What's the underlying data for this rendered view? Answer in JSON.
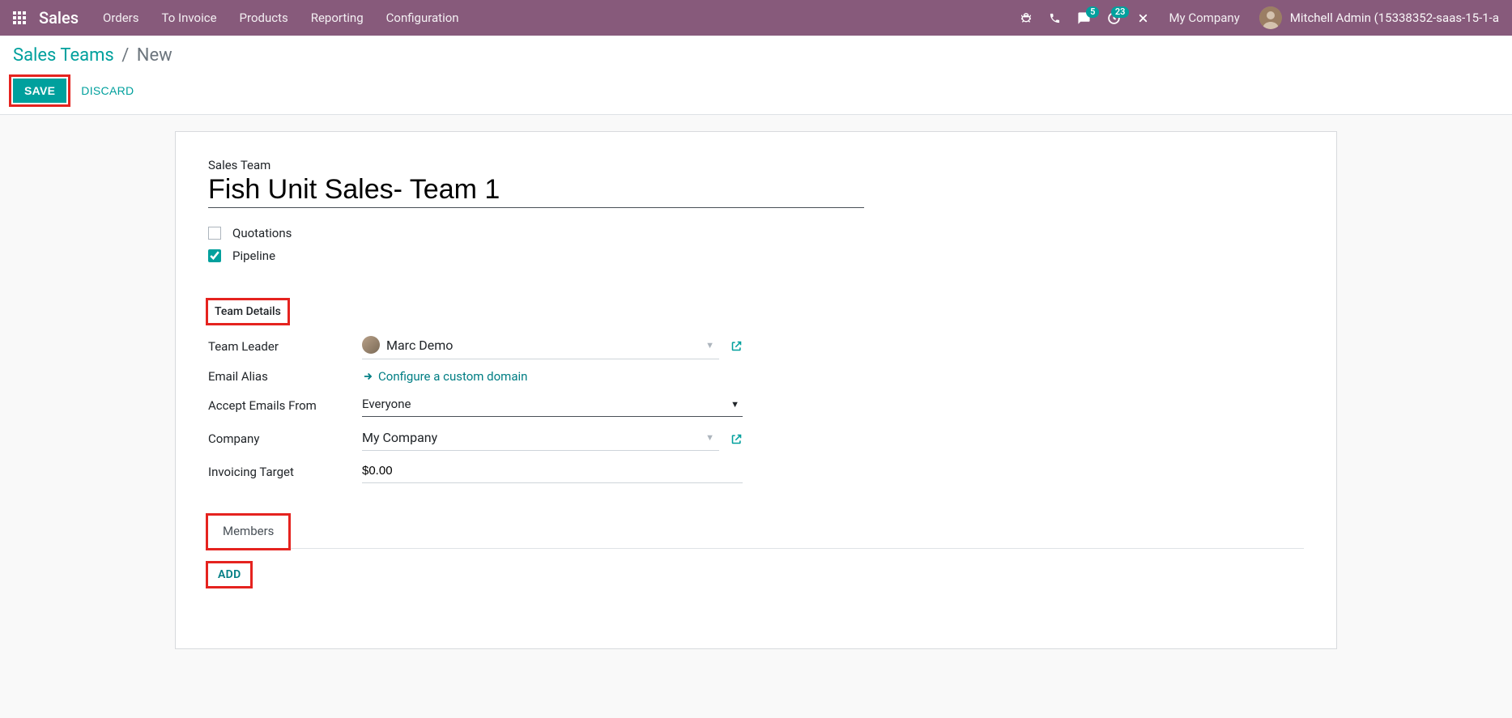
{
  "navbar": {
    "brand": "Sales",
    "menu": [
      "Orders",
      "To Invoice",
      "Products",
      "Reporting",
      "Configuration"
    ],
    "messages_badge": "5",
    "activities_badge": "23",
    "company": "My Company",
    "user": "Mitchell Admin (15338352-saas-15-1-a"
  },
  "breadcrumb": {
    "parent": "Sales Teams",
    "current": "New"
  },
  "buttons": {
    "save": "SAVE",
    "discard": "DISCARD"
  },
  "form": {
    "title_label": "Sales Team",
    "title_value": "Fish Unit Sales- Team 1",
    "checks": {
      "quotations_label": "Quotations",
      "quotations_checked": false,
      "pipeline_label": "Pipeline",
      "pipeline_checked": true
    },
    "section_details": "Team Details",
    "fields": {
      "team_leader_label": "Team Leader",
      "team_leader_value": "Marc Demo",
      "email_alias_label": "Email Alias",
      "email_alias_link": "Configure a custom domain",
      "accept_emails_label": "Accept Emails From",
      "accept_emails_value": "Everyone",
      "company_label": "Company",
      "company_value": "My Company",
      "invoicing_target_label": "Invoicing Target",
      "invoicing_target_value": "$0.00"
    },
    "tabs": {
      "members": "Members"
    },
    "add_button": "ADD"
  }
}
